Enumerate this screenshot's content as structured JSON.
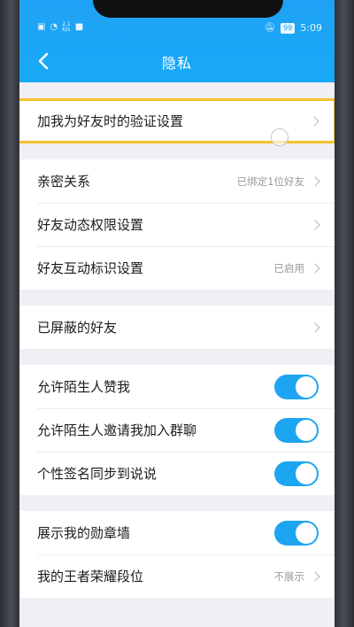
{
  "statusbar": {
    "time": "5:09",
    "battery": "99",
    "net_top": "2.1",
    "net_bottom": "K/s"
  },
  "header": {
    "title": "隐私",
    "back_icon": "chevron-left-icon"
  },
  "groups": [
    {
      "rows": [
        {
          "label": "加我为好友时的验证设置",
          "value": "",
          "highlighted": true
        }
      ]
    },
    {
      "rows": [
        {
          "label": "亲密关系",
          "value": "已绑定1位好友"
        },
        {
          "label": "好友动态权限设置",
          "value": ""
        },
        {
          "label": "好友互动标识设置",
          "value": "已启用"
        }
      ]
    },
    {
      "rows": [
        {
          "label": "已屏蔽的好友",
          "value": ""
        }
      ]
    },
    {
      "rows": [
        {
          "label": "允许陌生人赞我",
          "toggle": true
        },
        {
          "label": "允许陌生人邀请我加入群聊",
          "toggle": true
        },
        {
          "label": "个性签名同步到说说",
          "toggle": true
        }
      ]
    },
    {
      "rows": [
        {
          "label": "展示我的勋章墙",
          "toggle": true
        },
        {
          "label": "我的王者荣耀段位",
          "value": "不展示"
        }
      ]
    }
  ],
  "colors": {
    "accent": "#1ea5f2",
    "highlight": "#f5c230",
    "header": "#1fa2f5"
  }
}
